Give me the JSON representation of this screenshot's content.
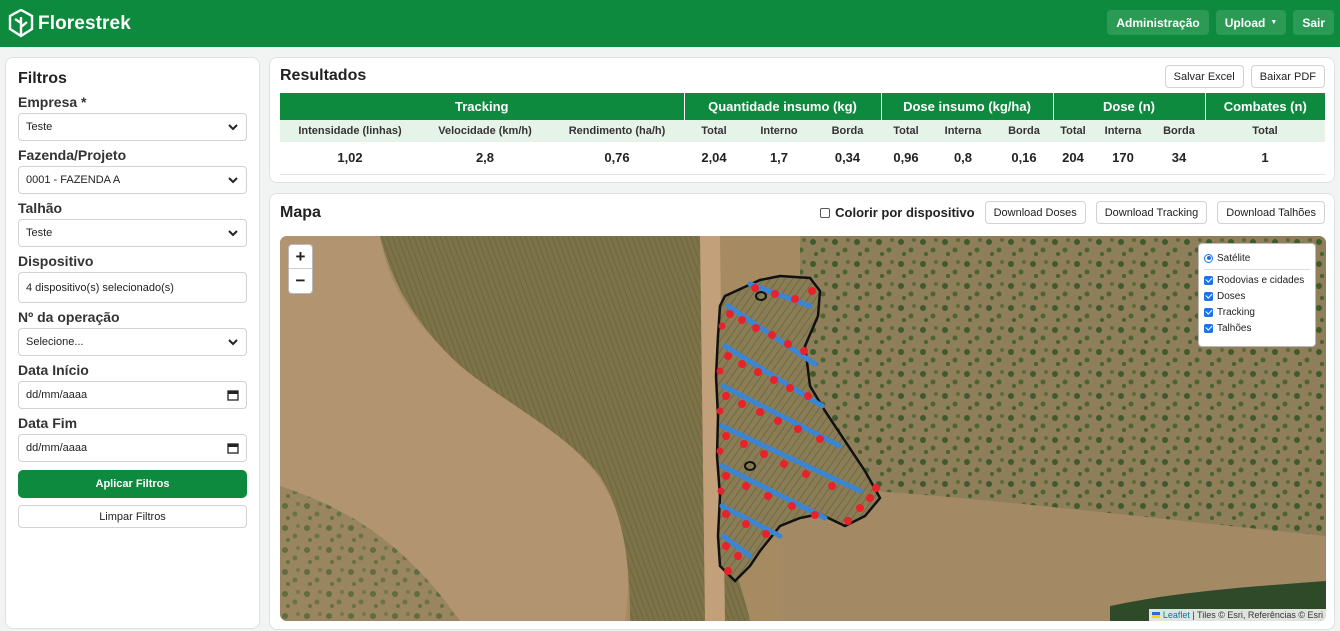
{
  "navbar": {
    "brand": "Florestrek",
    "admin": "Administração",
    "upload": "Upload",
    "logout": "Sair",
    "brand_color": "#0e8a3e"
  },
  "filters": {
    "title": "Filtros",
    "empresa_label": "Empresa *",
    "empresa_value": "Teste",
    "fazenda_label": "Fazenda/Projeto",
    "fazenda_value": "0001 - FAZENDA A",
    "talhao_label": "Talhão",
    "talhao_value": "Teste",
    "dispositivo_label": "Dispositivo",
    "dispositivo_value": "4 dispositivo(s) selecionado(s)",
    "operacao_label": "Nº da operação",
    "operacao_value": "Selecione...",
    "data_inicio_label": "Data Início",
    "data_inicio_placeholder": "dd/mm/aaaa",
    "data_fim_label": "Data Fim",
    "data_fim_placeholder": "dd/mm/aaaa",
    "apply": "Aplicar Filtros",
    "clear": "Limpar Filtros"
  },
  "results": {
    "title": "Resultados",
    "save_excel": "Salvar Excel",
    "download_pdf": "Baixar PDF",
    "groups": [
      {
        "label": "Tracking",
        "span": 3
      },
      {
        "label": "Quantidade insumo (kg)",
        "span": 3
      },
      {
        "label": "Dose insumo (kg/ha)",
        "span": 3
      },
      {
        "label": "Dose (n)",
        "span": 3
      },
      {
        "label": "Combates (n)",
        "span": 1
      }
    ],
    "subheaders": [
      "Intensidade (linhas)",
      "Velocidade (km/h)",
      "Rendimento (ha/h)",
      "Total",
      "Interno",
      "Borda",
      "Total",
      "Interna",
      "Borda",
      "Total",
      "Interna",
      "Borda",
      "Total"
    ],
    "values": [
      "1,02",
      "2,8",
      "0,76",
      "2,04",
      "1,7",
      "0,34",
      "0,96",
      "0,8",
      "0,16",
      "204",
      "170",
      "34",
      "1"
    ]
  },
  "map": {
    "title": "Mapa",
    "color_by_device": "Colorir por dispositivo",
    "download_doses": "Download Doses",
    "download_tracking": "Download Tracking",
    "download_talhoes": "Download Talhões",
    "zoom_in": "+",
    "zoom_out": "−",
    "base_layer": "Satélite",
    "overlays": [
      "Rodovias e cidades",
      "Doses",
      "Tracking",
      "Talhões"
    ],
    "attribution_leaflet": "Leaflet",
    "attribution_rest": " | Tiles © Esri, Referências © Esri",
    "dose_color": "#e8222a",
    "tracking_color": "#3a86d4"
  }
}
